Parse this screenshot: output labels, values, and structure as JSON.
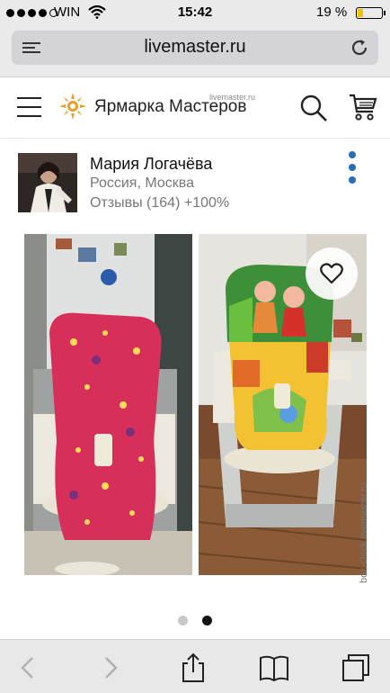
{
  "status_bar": {
    "carrier": "WIN",
    "time": "15:42",
    "battery": "19 %",
    "signal_icon": "signal-dots-icon",
    "wifi_icon": "wifi-icon",
    "battery_icon": "battery-icon"
  },
  "browser": {
    "url": "livemaster.ru",
    "menu_icon": "reader-icon",
    "reload_icon": "reload-icon"
  },
  "site_header": {
    "logo_small": "livemaster.ru",
    "logo_text": "Ярмарка Мастеров",
    "logo_icon": "sun-logo-icon",
    "brand_color": "#e8a02a",
    "menu_icon": "hamburger-icon",
    "search_icon": "search-icon",
    "cart_icon": "cart-icon"
  },
  "seller": {
    "name": "Мария Логачёва",
    "location": "Россия, Москва",
    "reviews": "Отзывы (164) +100%",
    "more_icon": "more-vertical-icon",
    "accent": "#2a6db5"
  },
  "product": {
    "favorite_icon": "heart-icon",
    "watermark": "box-clock.livemaster.ru",
    "slide_index": 2,
    "slide_count": 2
  },
  "toolbar": {
    "back_icon": "back-icon",
    "forward_icon": "forward-icon",
    "share_icon": "share-icon",
    "bookmarks_icon": "bookmarks-icon",
    "tabs_icon": "tabs-icon"
  }
}
